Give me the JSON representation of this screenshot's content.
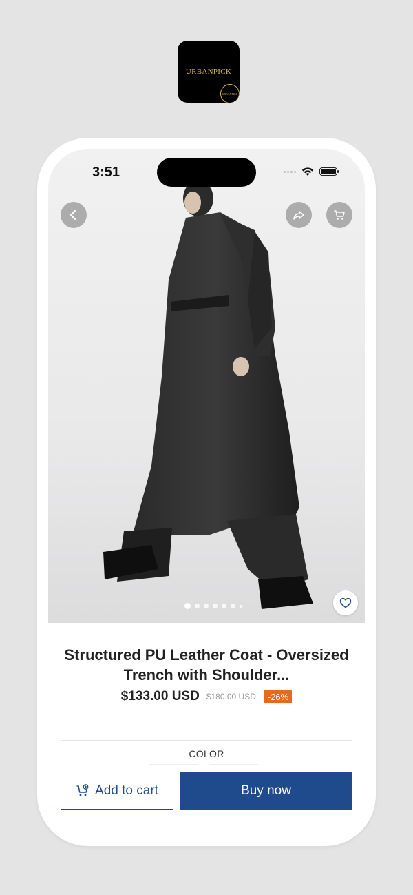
{
  "app_icon": {
    "brand": "URBANPICK",
    "seal_text": "URBANPICK"
  },
  "status_bar": {
    "time": "3:51"
  },
  "product": {
    "title": "Structured PU Leather Coat - Oversized Trench with Shoulder...",
    "price": "$133.00 USD",
    "old_price": "$180.00 USD",
    "discount": "-26%",
    "image_count": 7,
    "active_image": 1
  },
  "options": {
    "color_label": "COLOR"
  },
  "actions": {
    "add_to_cart": "Add to cart",
    "buy_now": "Buy now"
  },
  "icons": {
    "back": "chevron-left-icon",
    "share": "share-icon",
    "cart": "cart-icon",
    "wishlist": "heart-icon"
  },
  "colors": {
    "accent": "#1f4a8c",
    "discount": "#e8691c",
    "brand_gold": "#d9b25a"
  }
}
